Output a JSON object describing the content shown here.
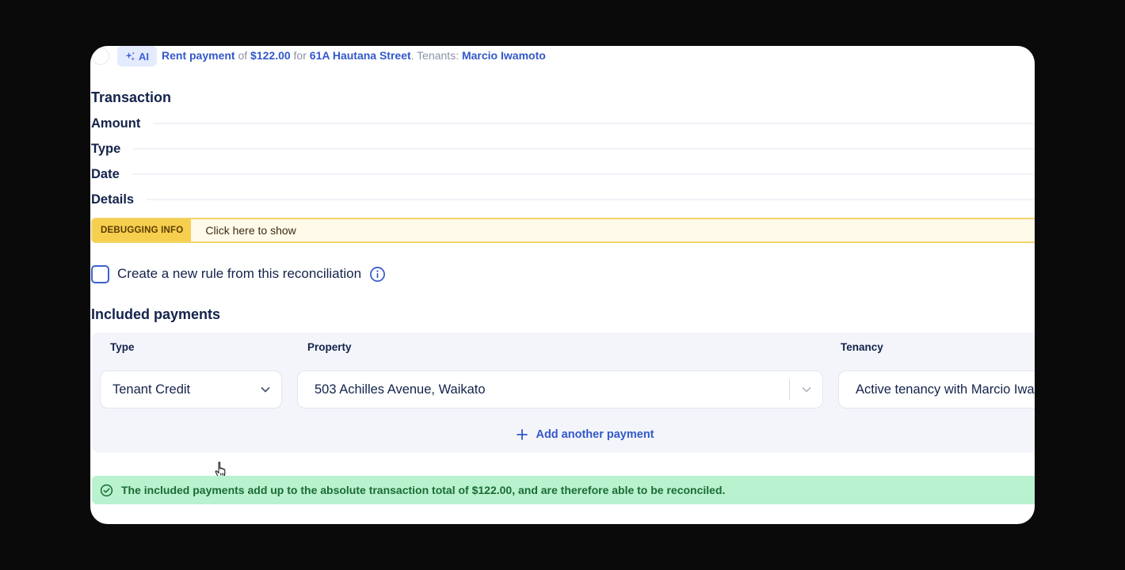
{
  "ai_suggestion": {
    "badge_label": "AI",
    "payment_type": "Rent payment",
    "of_word": " of ",
    "amount": "$122.00",
    "for_word": " for ",
    "property": "61A Hautana Street",
    "tenants_prefix": ". Tenants: ",
    "tenant": "Marcio Iwamoto"
  },
  "transaction": {
    "title": "Transaction",
    "fields": {
      "amount_label": "Amount",
      "type_label": "Type",
      "date_label": "Date",
      "details_label": "Details"
    }
  },
  "debugging": {
    "tag": "DEBUGGING INFO",
    "link": "Click here to show"
  },
  "rule": {
    "label": "Create a new rule from this reconciliation",
    "checked": false
  },
  "payments": {
    "title": "Included payments",
    "columns": {
      "type": "Type",
      "property": "Property",
      "tenancy": "Tenancy"
    },
    "row": {
      "type_value": "Tenant Credit",
      "property_value": "503 Achilles Avenue, Waikato",
      "tenancy_value": "Active tenancy with Marcio Iwamoto"
    },
    "add_label": "Add another payment"
  },
  "status": {
    "message": "The included payments add up to the absolute transaction total of $122.00, and are therefore able to be reconciled.",
    "color": "#b9f2cf"
  },
  "colors": {
    "accent": "#3358c9",
    "debug": "#f7cf4f",
    "success_text": "#1a6b35"
  },
  "icons": {
    "ai": "sparkle-icon",
    "info": "info-icon",
    "chevron": "chevron-down-icon",
    "plus": "plus-icon",
    "check": "check-circle-icon",
    "cursor": "hand-cursor-icon"
  }
}
